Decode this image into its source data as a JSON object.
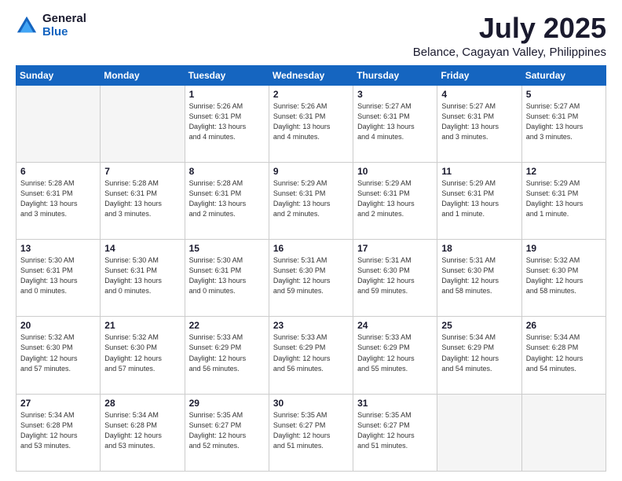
{
  "logo": {
    "general": "General",
    "blue": "Blue"
  },
  "title": "July 2025",
  "subtitle": "Belance, Cagayan Valley, Philippines",
  "days_of_week": [
    "Sunday",
    "Monday",
    "Tuesday",
    "Wednesday",
    "Thursday",
    "Friday",
    "Saturday"
  ],
  "weeks": [
    [
      {
        "day": "",
        "info": ""
      },
      {
        "day": "",
        "info": ""
      },
      {
        "day": "1",
        "info": "Sunrise: 5:26 AM\nSunset: 6:31 PM\nDaylight: 13 hours\nand 4 minutes."
      },
      {
        "day": "2",
        "info": "Sunrise: 5:26 AM\nSunset: 6:31 PM\nDaylight: 13 hours\nand 4 minutes."
      },
      {
        "day": "3",
        "info": "Sunrise: 5:27 AM\nSunset: 6:31 PM\nDaylight: 13 hours\nand 4 minutes."
      },
      {
        "day": "4",
        "info": "Sunrise: 5:27 AM\nSunset: 6:31 PM\nDaylight: 13 hours\nand 3 minutes."
      },
      {
        "day": "5",
        "info": "Sunrise: 5:27 AM\nSunset: 6:31 PM\nDaylight: 13 hours\nand 3 minutes."
      }
    ],
    [
      {
        "day": "6",
        "info": "Sunrise: 5:28 AM\nSunset: 6:31 PM\nDaylight: 13 hours\nand 3 minutes."
      },
      {
        "day": "7",
        "info": "Sunrise: 5:28 AM\nSunset: 6:31 PM\nDaylight: 13 hours\nand 3 minutes."
      },
      {
        "day": "8",
        "info": "Sunrise: 5:28 AM\nSunset: 6:31 PM\nDaylight: 13 hours\nand 2 minutes."
      },
      {
        "day": "9",
        "info": "Sunrise: 5:29 AM\nSunset: 6:31 PM\nDaylight: 13 hours\nand 2 minutes."
      },
      {
        "day": "10",
        "info": "Sunrise: 5:29 AM\nSunset: 6:31 PM\nDaylight: 13 hours\nand 2 minutes."
      },
      {
        "day": "11",
        "info": "Sunrise: 5:29 AM\nSunset: 6:31 PM\nDaylight: 13 hours\nand 1 minute."
      },
      {
        "day": "12",
        "info": "Sunrise: 5:29 AM\nSunset: 6:31 PM\nDaylight: 13 hours\nand 1 minute."
      }
    ],
    [
      {
        "day": "13",
        "info": "Sunrise: 5:30 AM\nSunset: 6:31 PM\nDaylight: 13 hours\nand 0 minutes."
      },
      {
        "day": "14",
        "info": "Sunrise: 5:30 AM\nSunset: 6:31 PM\nDaylight: 13 hours\nand 0 minutes."
      },
      {
        "day": "15",
        "info": "Sunrise: 5:30 AM\nSunset: 6:31 PM\nDaylight: 13 hours\nand 0 minutes."
      },
      {
        "day": "16",
        "info": "Sunrise: 5:31 AM\nSunset: 6:30 PM\nDaylight: 12 hours\nand 59 minutes."
      },
      {
        "day": "17",
        "info": "Sunrise: 5:31 AM\nSunset: 6:30 PM\nDaylight: 12 hours\nand 59 minutes."
      },
      {
        "day": "18",
        "info": "Sunrise: 5:31 AM\nSunset: 6:30 PM\nDaylight: 12 hours\nand 58 minutes."
      },
      {
        "day": "19",
        "info": "Sunrise: 5:32 AM\nSunset: 6:30 PM\nDaylight: 12 hours\nand 58 minutes."
      }
    ],
    [
      {
        "day": "20",
        "info": "Sunrise: 5:32 AM\nSunset: 6:30 PM\nDaylight: 12 hours\nand 57 minutes."
      },
      {
        "day": "21",
        "info": "Sunrise: 5:32 AM\nSunset: 6:30 PM\nDaylight: 12 hours\nand 57 minutes."
      },
      {
        "day": "22",
        "info": "Sunrise: 5:33 AM\nSunset: 6:29 PM\nDaylight: 12 hours\nand 56 minutes."
      },
      {
        "day": "23",
        "info": "Sunrise: 5:33 AM\nSunset: 6:29 PM\nDaylight: 12 hours\nand 56 minutes."
      },
      {
        "day": "24",
        "info": "Sunrise: 5:33 AM\nSunset: 6:29 PM\nDaylight: 12 hours\nand 55 minutes."
      },
      {
        "day": "25",
        "info": "Sunrise: 5:34 AM\nSunset: 6:29 PM\nDaylight: 12 hours\nand 54 minutes."
      },
      {
        "day": "26",
        "info": "Sunrise: 5:34 AM\nSunset: 6:28 PM\nDaylight: 12 hours\nand 54 minutes."
      }
    ],
    [
      {
        "day": "27",
        "info": "Sunrise: 5:34 AM\nSunset: 6:28 PM\nDaylight: 12 hours\nand 53 minutes."
      },
      {
        "day": "28",
        "info": "Sunrise: 5:34 AM\nSunset: 6:28 PM\nDaylight: 12 hours\nand 53 minutes."
      },
      {
        "day": "29",
        "info": "Sunrise: 5:35 AM\nSunset: 6:27 PM\nDaylight: 12 hours\nand 52 minutes."
      },
      {
        "day": "30",
        "info": "Sunrise: 5:35 AM\nSunset: 6:27 PM\nDaylight: 12 hours\nand 51 minutes."
      },
      {
        "day": "31",
        "info": "Sunrise: 5:35 AM\nSunset: 6:27 PM\nDaylight: 12 hours\nand 51 minutes."
      },
      {
        "day": "",
        "info": ""
      },
      {
        "day": "",
        "info": ""
      }
    ]
  ]
}
